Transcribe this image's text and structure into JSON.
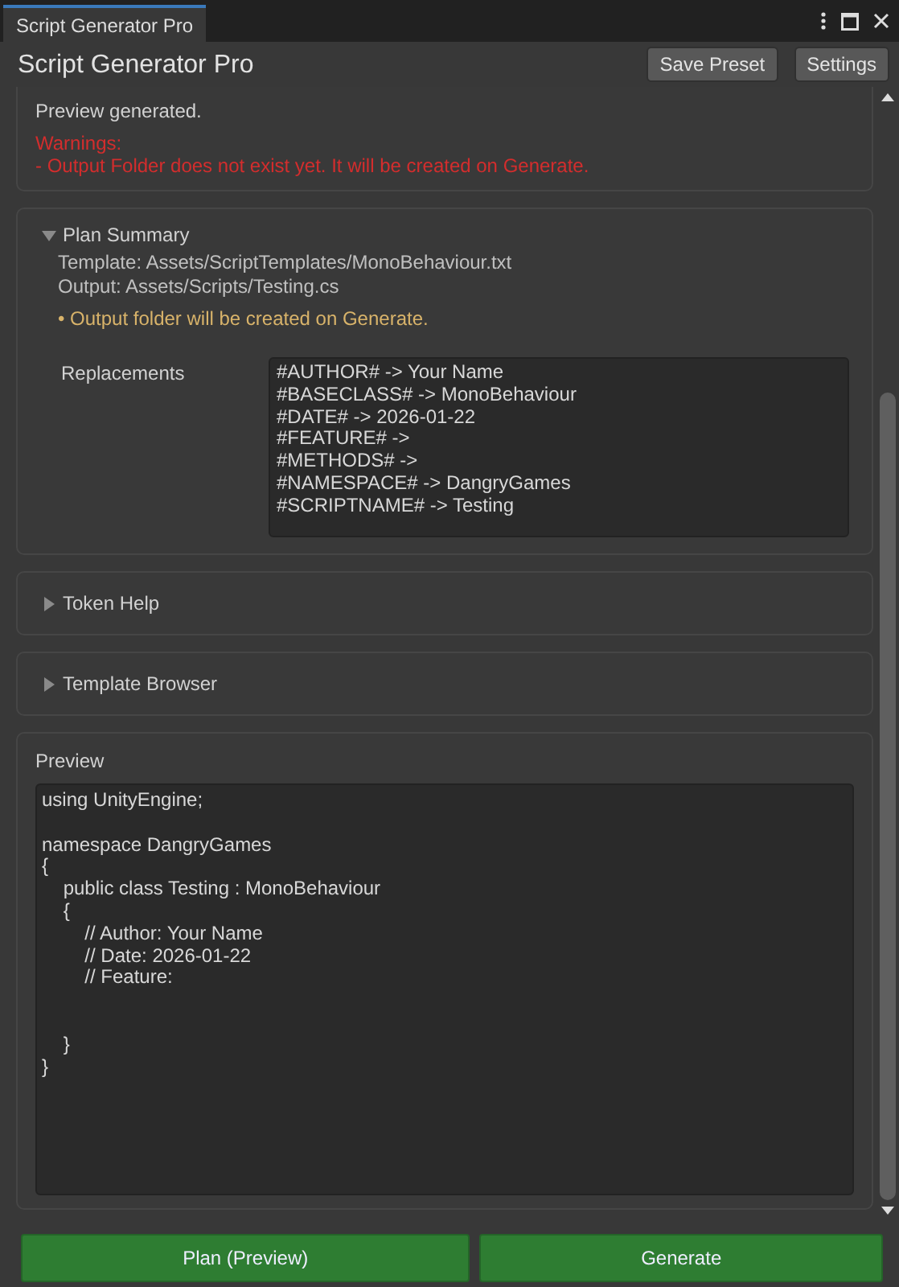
{
  "window": {
    "tab": "Script Generator Pro"
  },
  "header": {
    "title": "Script Generator Pro",
    "buttons": [
      "Save Preset",
      "Settings"
    ]
  },
  "status": {
    "message": "Preview generated.",
    "warnings": [
      "Warnings:",
      "- Output Folder does not exist yet. It will be created on Generate."
    ]
  },
  "plan_summary": {
    "title": "Plan Summary",
    "expanded": true,
    "lines": [
      "Template: Assets/ScriptTemplates/MonoBehaviour.txt",
      "Output: Assets/Scripts/Testing.cs"
    ],
    "note": "• Output folder will be created on Generate.",
    "replacements_label": "Replacements",
    "replacements": [
      "#AUTHOR# -> Your Name",
      "#BASECLASS# -> MonoBehaviour",
      "#DATE# -> 2026-01-22",
      "#FEATURE# ->",
      "#METHODS# ->",
      "#NAMESPACE# -> DangryGames",
      "#SCRIPTNAME# -> Testing"
    ]
  },
  "foldouts": [
    {
      "title": "Token Help",
      "expanded": false
    },
    {
      "title": "Template Browser",
      "expanded": false
    }
  ],
  "preview": {
    "title": "Preview",
    "code": "using UnityEngine;\n\nnamespace DangryGames\n{\n    public class Testing : MonoBehaviour\n    {\n        // Author: Your Name\n        // Date: 2026-01-22\n        // Feature:\n\n\n    }\n}"
  },
  "actions": [
    "Plan (Preview)",
    "Generate"
  ]
}
